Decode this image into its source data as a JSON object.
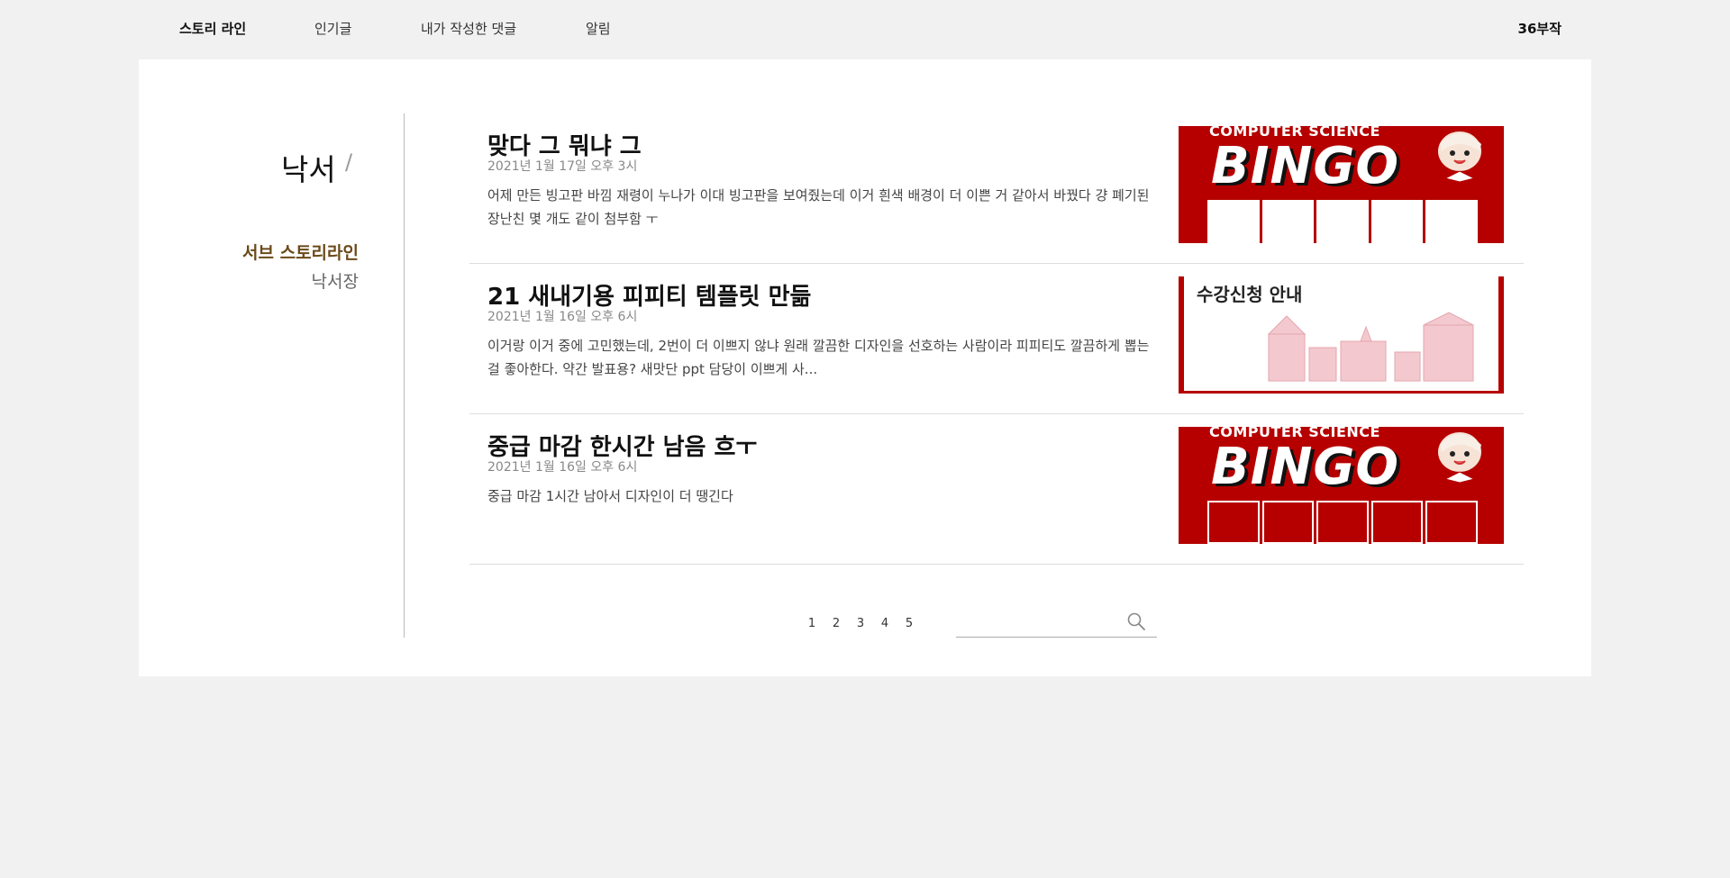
{
  "topnav": {
    "items": [
      {
        "label": "스토리 라인",
        "active": true
      },
      {
        "label": "인기글",
        "active": false
      },
      {
        "label": "내가 작성한 댓글",
        "active": false
      },
      {
        "label": "알림",
        "active": false
      }
    ],
    "user": "36부작"
  },
  "sidebar": {
    "title": "낙서",
    "separator": "/",
    "current_sub": "서브 스토리라인",
    "other_sub": "낙서장"
  },
  "posts": [
    {
      "title": "맞다 그 뭐냐 그",
      "date": "2021년 1월 17일 오후 3시",
      "excerpt": "어제 만든 빙고판 바낌 재령이 누나가 이대 빙고판을 보여줬는데 이거 흰색 배경이 더 이쁜 거 같아서 바꿨다 걍 폐기된 장난친 몇 개도 같이 첨부함 ㅜ",
      "thumb_type": "bingo",
      "thumb_top_text": "COMPUTER SCIENCE",
      "thumb_word": "BINGO"
    },
    {
      "title": "21 새내기용 피피티 템플릿 만듦",
      "date": "2021년 1월 16일 오후 6시",
      "excerpt": "이거랑 이거 중에 고민했는데, 2번이 더 이쁘지 않냐 원래 깔끔한 디자인을 선호하는 사람이라 피피티도 깔끔하게 뽑는 걸 좋아한다. 약간 발표용? 새맛단 ppt 담당이 이쁘게 사...",
      "thumb_type": "notice",
      "thumb_text": "수강신청 안내"
    },
    {
      "title": "중급 마감 한시간 남음 흐ㅜ",
      "date": "2021년 1월 16일 오후 6시",
      "excerpt": "중급 마감 1시간 남아서 디자인이 더 땡긴다",
      "thumb_type": "bingo",
      "thumb_top_text": "COMPUTER SCIENCE",
      "thumb_word": "BINGO"
    }
  ],
  "pagination": [
    "1",
    "2",
    "3",
    "4",
    "5"
  ],
  "search": {
    "placeholder": ""
  },
  "colors": {
    "accent_brown": "#6b4a1a",
    "brand_red": "#b60000"
  }
}
